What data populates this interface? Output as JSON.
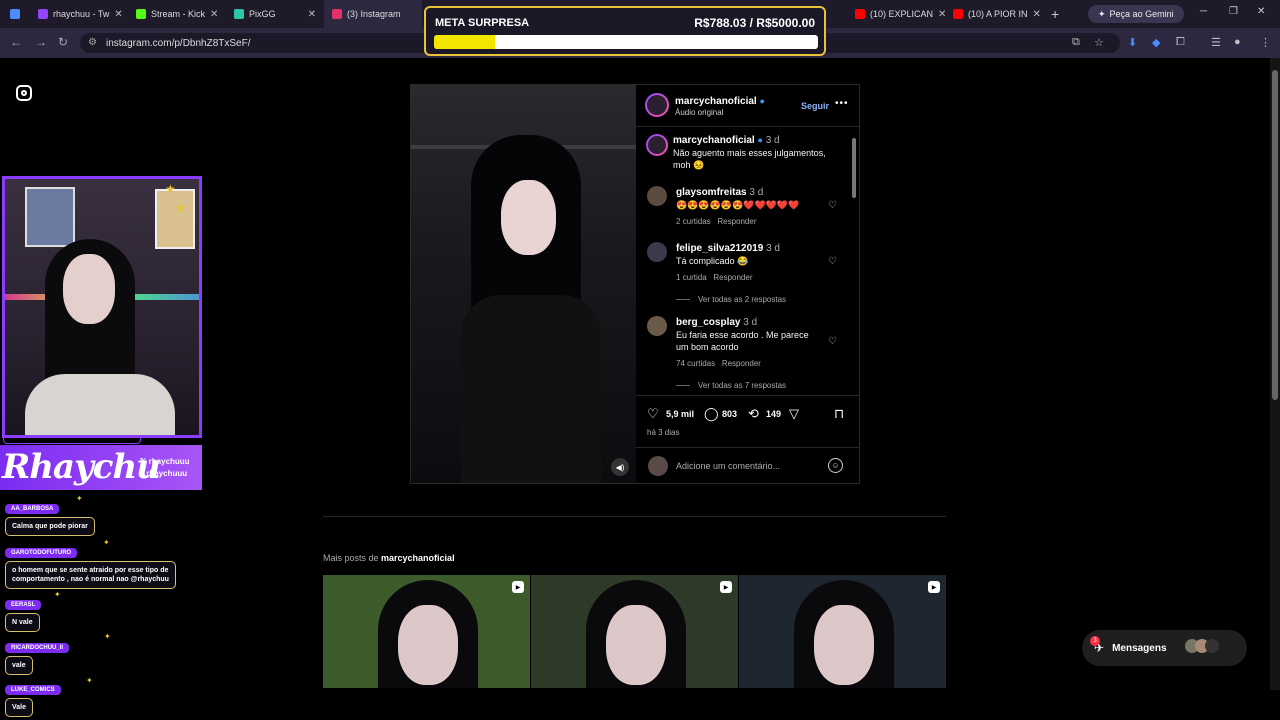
{
  "browser": {
    "tabs": [
      {
        "label": "",
        "color": "#4a8cff"
      },
      {
        "label": "rhaychuu - Tw",
        "color": "#9146ff"
      },
      {
        "label": "Stream - Kick",
        "color": "#53fc18"
      },
      {
        "label": "PixGG",
        "color": "#2ec4a6"
      },
      {
        "label": "(3) Instagram",
        "color": "#e1306c"
      },
      {
        "label": "(10) EXPLICAN",
        "color": "#ff0000"
      },
      {
        "label": "(10) A PIOR IN",
        "color": "#ff0000"
      }
    ],
    "gemini_label": "Peça ao Gemini",
    "url": "instagram.com/p/DbnhZ8TxSeF/"
  },
  "goal": {
    "title": "META SURPRESA",
    "amount": "R$788.03 / R$5000.00",
    "progress": 0.158
  },
  "post": {
    "author": "marcychanoficial",
    "audio": "Áudio original",
    "follow_label": "Seguir",
    "caption_author": "marcychanoficial",
    "caption_time": "3 d",
    "caption": "Não aguento mais esses julgamentos, moh 😣",
    "comments": [
      {
        "user": "glaysomfreitas",
        "time": "3 d",
        "text": "😍😍😍😍😍😍❤️❤️❤️❤️❤️",
        "likes": "2 curtidas",
        "reply": "Responder",
        "view_replies": ""
      },
      {
        "user": "felipe_silva212019",
        "time": "3 d",
        "text": "Tá complicado 😂",
        "likes": "1 curtida",
        "reply": "Responder",
        "view_replies": "Ver todas as 2 respostas"
      },
      {
        "user": "berg_cosplay",
        "time": "3 d",
        "text": "Eu faria esse acordo . Me parece um bom acordo",
        "likes": "74 curtidas",
        "reply": "Responder",
        "view_replies": "Ver todas as 7 respostas"
      }
    ],
    "likes": "5,9 mil",
    "comments_count": "803",
    "reposts": "149",
    "posted": "há 3 dias",
    "add_comment_placeholder": "Adicione um comentário..."
  },
  "more_posts": {
    "prefix": "Mais posts de ",
    "author": "marcychanoficial",
    "thumbs": [
      {
        "bg": "#3d5a2a"
      },
      {
        "bg": "#2e3a28"
      },
      {
        "bg": "#1e2630"
      }
    ]
  },
  "messages": {
    "label": "Mensagens",
    "badge": "3"
  },
  "stream_overlay": {
    "brand": "Rhaychu",
    "socials": [
      "rhaychuuu",
      "rhaychuuu"
    ],
    "chat": [
      {
        "user": "AA_BARBOSA",
        "message": "Calma que pode piorar"
      },
      {
        "user": "GAROTODOFUTURO",
        "message": "o homem que se sente atraido por esse tipo de\ncomportamento , nao é normal nao @rhaychuu"
      },
      {
        "user": "EERASL",
        "message": "N vale"
      },
      {
        "user": "RICARDOCHUU_II",
        "message": "vale"
      },
      {
        "user": "LUKE_COMICS",
        "message": "Vale"
      }
    ]
  },
  "colors": {
    "accent": "#8a3cff",
    "goal_border": "#e8c23a",
    "goal_fill": "#f2e600",
    "link": "#8ab4f8"
  },
  "icons": [
    "instagram-icon",
    "heart-icon",
    "comment-icon",
    "repost-icon",
    "share-icon",
    "bookmark-icon",
    "emoji-icon",
    "volume-icon",
    "messages-icon",
    "verified-icon"
  ]
}
